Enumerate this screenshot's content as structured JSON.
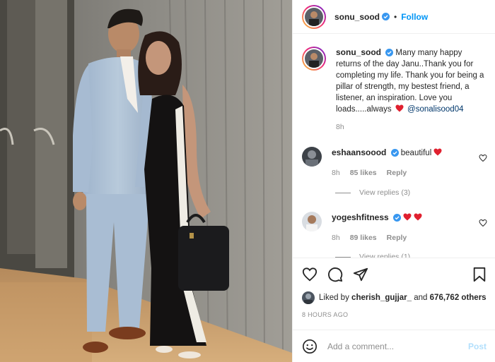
{
  "post": {
    "username": "sonu_sood",
    "follow_label": "Follow",
    "dot": "•",
    "caption": {
      "text": "Many many happy returns of the day Janu..Thank you for completing my life. Thank you for being a pillar of strength, my bestest friend, a listener, an inspiration. Love you loads.....always",
      "mention": "@sonalisood04",
      "age": "8h"
    },
    "comments": [
      {
        "username": "eshaansoood",
        "text": "beautiful",
        "age": "8h",
        "likes": "85 likes",
        "reply": "Reply",
        "view_replies": "View replies (3)"
      },
      {
        "username": "yogeshfitness",
        "text": "",
        "age": "8h",
        "likes": "89 likes",
        "reply": "Reply",
        "view_replies": "View replies (1)"
      }
    ],
    "liked_by": {
      "prefix": "Liked by",
      "user": "cherish_gujjar_",
      "joiner": "and",
      "count": "676,762 others"
    },
    "timestamp": "8 HOURS AGO",
    "add_comment": {
      "placeholder": "Add a comment...",
      "post_label": "Post"
    },
    "colors": {
      "accent": "#0095f6",
      "heart": "#ed4956",
      "muted": "#8e8e8e",
      "post_disabled": "#b2dffc"
    },
    "icons": [
      "verified-icon",
      "heart-icon",
      "comment-icon",
      "share-icon",
      "bookmark-icon",
      "emoji-icon"
    ]
  }
}
